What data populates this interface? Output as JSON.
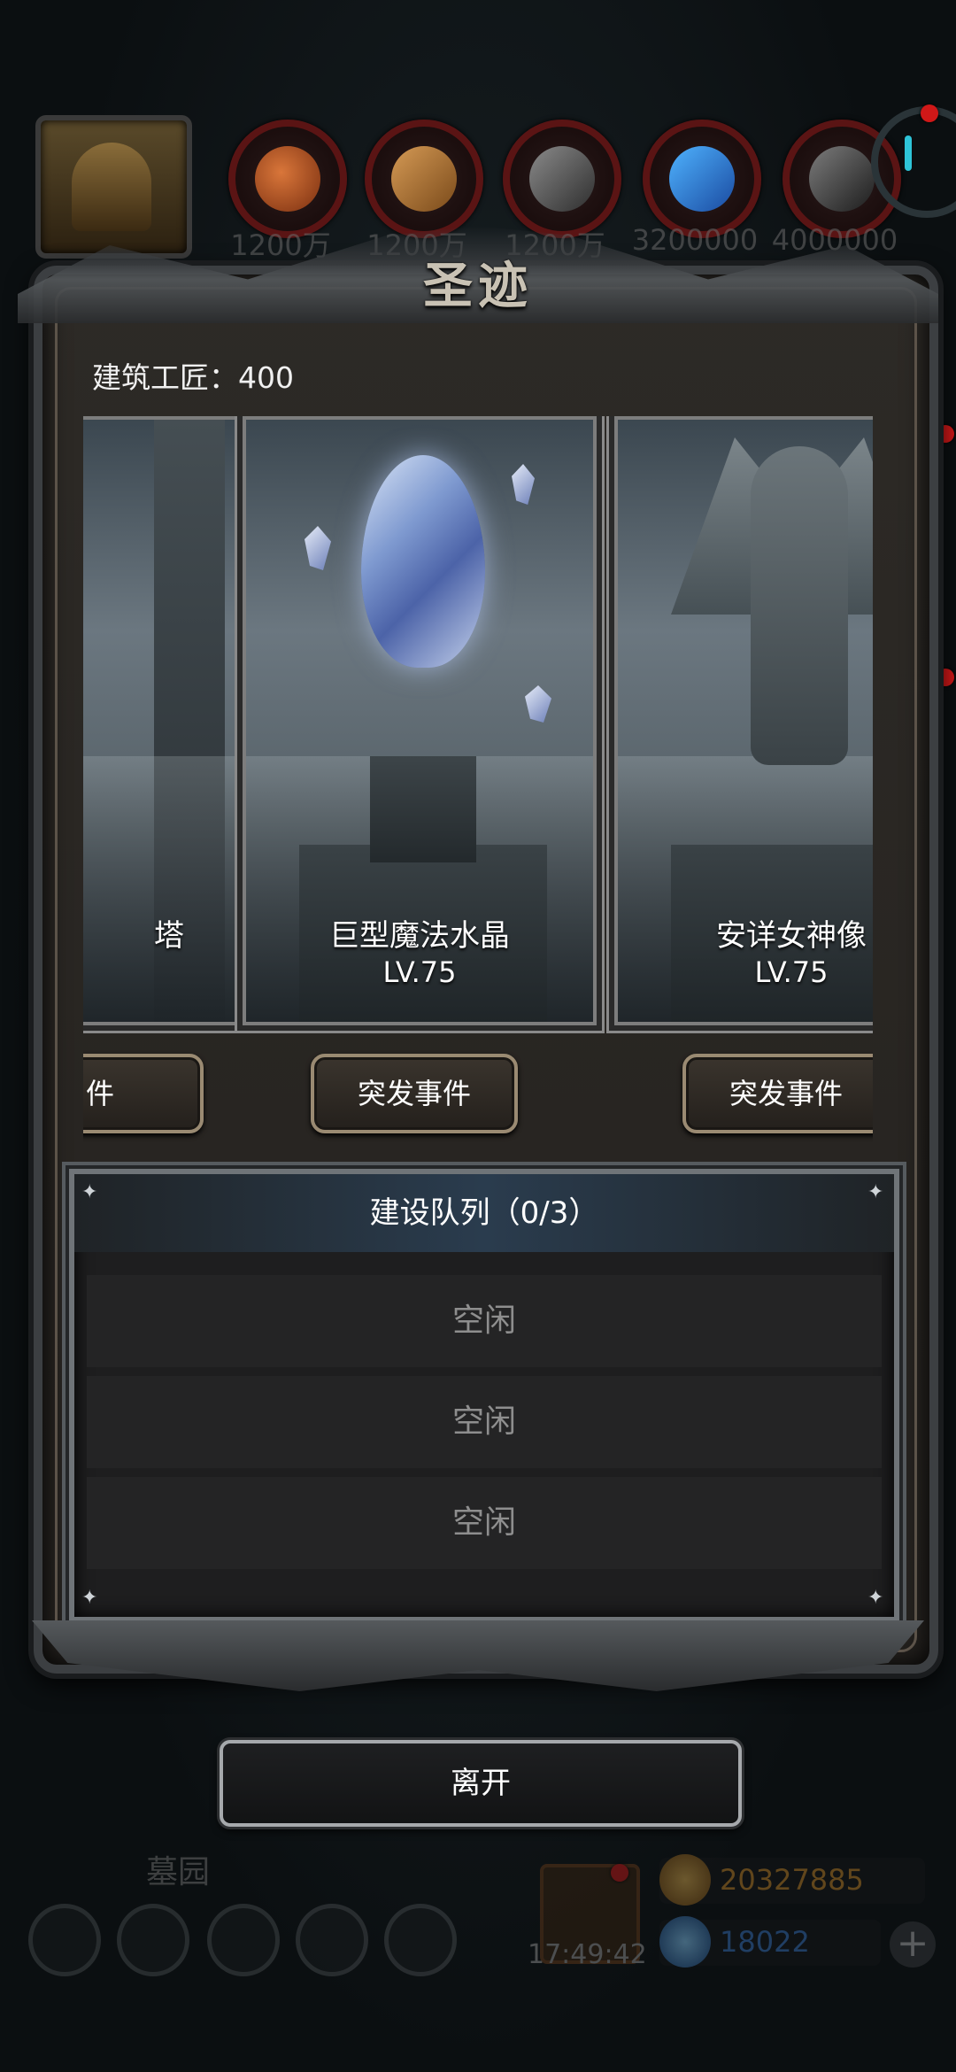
{
  "header": {
    "resources": [
      {
        "icon": "meat-icon",
        "value": "1200万"
      },
      {
        "icon": "wood-icon",
        "value": "1200万"
      },
      {
        "icon": "stone-icon",
        "value": "1200万"
      },
      {
        "icon": "crystal-icon",
        "value": "3200000"
      },
      {
        "icon": "iron-icon",
        "value": "4000000"
      }
    ]
  },
  "panel": {
    "title": "圣迹",
    "builder_label": "建筑工匠：400"
  },
  "cards": [
    {
      "name": "塔",
      "level": "",
      "button": "件"
    },
    {
      "name": "巨型魔法水晶",
      "level": "LV.75",
      "button": "突发事件"
    },
    {
      "name": "安详女神像",
      "level": "LV.75",
      "button": "突发事件"
    }
  ],
  "queue": {
    "title": "建设队列（0/3）",
    "slots": [
      "空闲",
      "空闲",
      "空闲"
    ]
  },
  "leave_button": "离开",
  "hud": {
    "area_name": "墓园",
    "timer": "17:49:42",
    "gold": "20327885",
    "gems": "18022"
  },
  "colors": {
    "gold_text": "#c98a2a",
    "gem_text": "#3a78c8",
    "accent_red": "#d01818"
  }
}
